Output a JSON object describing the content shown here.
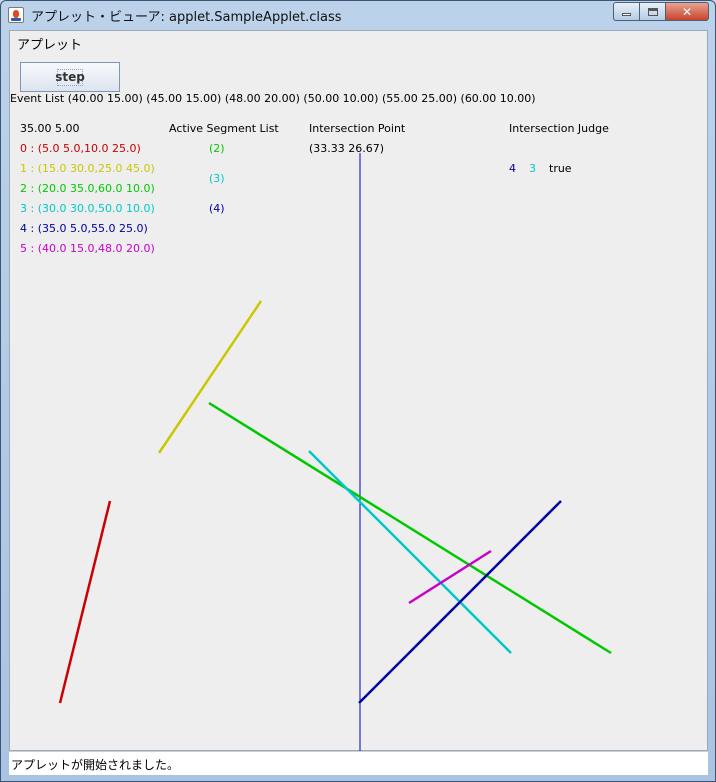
{
  "window": {
    "title": "アプレット・ビューア: applet.SampleApplet.class",
    "min_label": "",
    "max_label": "",
    "close_label": "✕"
  },
  "menu": {
    "applet_label": "アプレット"
  },
  "toolbar": {
    "step_label": "step"
  },
  "event_list": "Event List  (40.00 15.00)  (45.00 15.00)  (48.00 20.00)  (50.00 10.00)  (55.00 25.00)  (60.00 10.00)",
  "sweep": {
    "current": "35.00 5.00"
  },
  "segments": [
    {
      "label": "0 : (5.0 5.0,10.0 25.0)",
      "color": "#cc0000"
    },
    {
      "label": "1 : (15.0 30.0,25.0 45.0)",
      "color": "#c8c800"
    },
    {
      "label": "2 : (20.0 35.0,60.0 10.0)",
      "color": "#00c800"
    },
    {
      "label": "3 : (30.0 30.0,50.0 10.0)",
      "color": "#00c8c8"
    },
    {
      "label": "4 : (35.0 5.0,55.0 25.0)",
      "color": "#0000a0"
    },
    {
      "label": "5 : (40.0 15.0,48.0 20.0)",
      "color": "#c800c8"
    }
  ],
  "active_segments": {
    "header": "Active Segment List",
    "items": [
      {
        "label": "(2)",
        "color": "#00c800"
      },
      {
        "label": "(3)",
        "color": "#00c8c8"
      },
      {
        "label": "(4)",
        "color": "#0000a0"
      }
    ]
  },
  "intersection_point": {
    "header": "Intersection Point",
    "value": "(33.33 26.67)"
  },
  "intersection_judge": {
    "header": "Intersection Judge",
    "a": "4",
    "b": "3",
    "result": "true"
  },
  "status": {
    "text": "アプレットが開始されました。"
  },
  "sweep_line_color": "#0000cc"
}
